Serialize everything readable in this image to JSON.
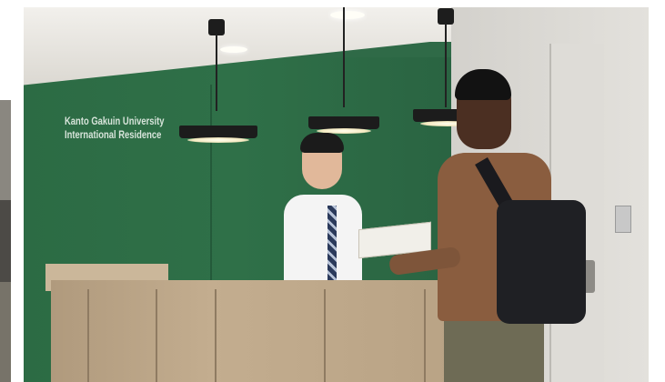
{
  "scene": {
    "description_tag": "reception-desk-photo",
    "wall_sign": {
      "line1": "Kanto Gakuin University",
      "line2": "International Residence"
    }
  }
}
